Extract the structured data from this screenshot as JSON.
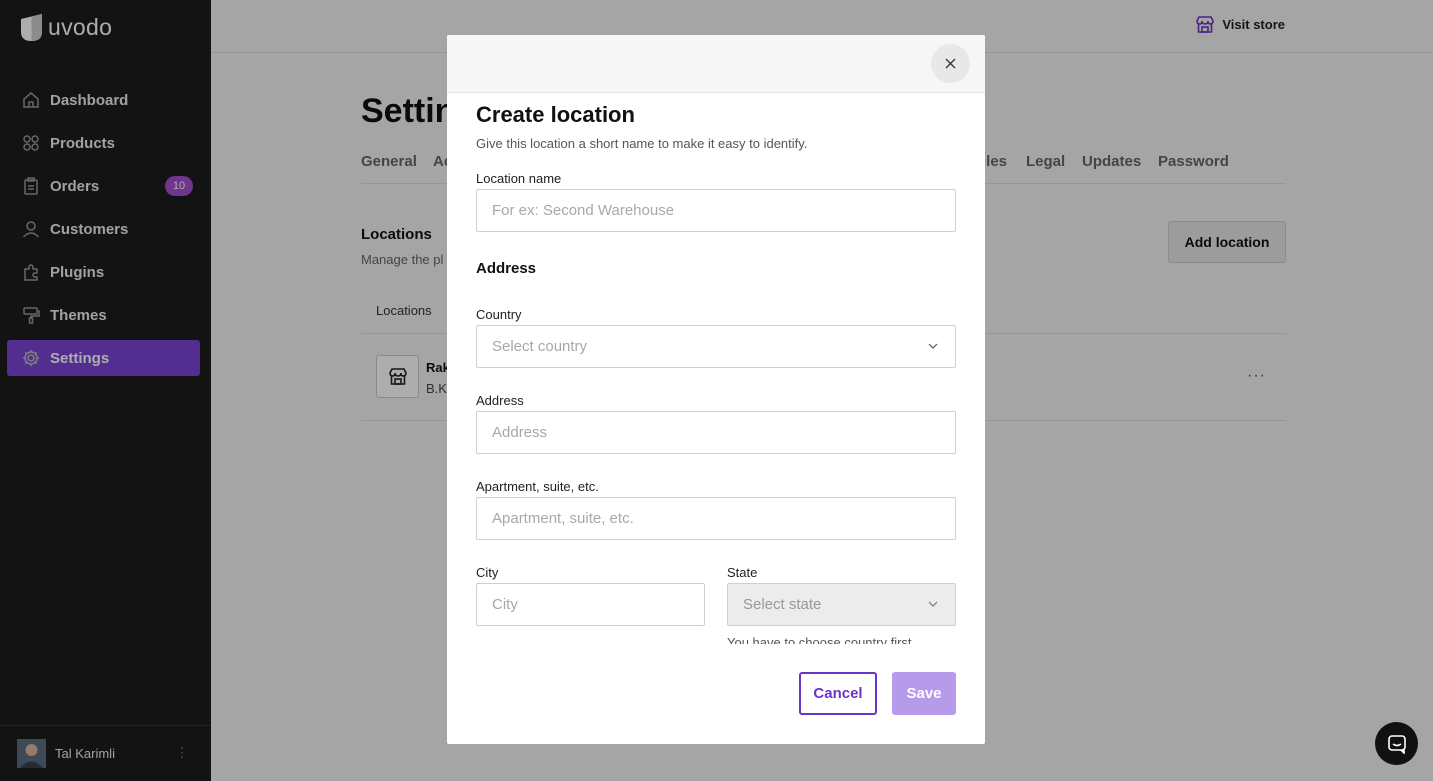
{
  "brand": {
    "name": "uvodo"
  },
  "sidebar": {
    "items": [
      {
        "label": "Dashboard",
        "icon": "home-icon"
      },
      {
        "label": "Products",
        "icon": "grid-icon"
      },
      {
        "label": "Orders",
        "icon": "clipboard-icon",
        "badge": "10"
      },
      {
        "label": "Customers",
        "icon": "user-icon"
      },
      {
        "label": "Plugins",
        "icon": "puzzle-icon"
      },
      {
        "label": "Themes",
        "icon": "paint-roller-icon"
      },
      {
        "label": "Settings",
        "icon": "gear-icon",
        "active": true
      }
    ],
    "user": {
      "name": "Tal Karimli"
    }
  },
  "topbar": {
    "visit_store": "Visit store"
  },
  "page": {
    "title": "Settin",
    "tabs": [
      "General",
      "Ac",
      "iles",
      "Legal",
      "Updates",
      "Password"
    ],
    "locations": {
      "title": "Locations",
      "subtitle": "Manage the pl",
      "add_button": "Add location",
      "table_header": "Locations",
      "row": {
        "name": "Rak",
        "address": "B.Kl"
      }
    }
  },
  "modal": {
    "title": "Create location",
    "subtitle": "Give this location a short name to make it easy to identify.",
    "location_name": {
      "label": "Location name",
      "placeholder": "For ex: Second Warehouse"
    },
    "address_heading": "Address",
    "country": {
      "label": "Country",
      "placeholder": "Select country"
    },
    "address": {
      "label": "Address",
      "placeholder": "Address"
    },
    "apartment": {
      "label": "Apartment, suite, etc.",
      "placeholder": "Apartment, suite, etc."
    },
    "city": {
      "label": "City",
      "placeholder": "City"
    },
    "state": {
      "label": "State",
      "placeholder": "Select state",
      "hint": "You have to choose country first"
    },
    "cancel": "Cancel",
    "save": "Save"
  },
  "colors": {
    "accent": "#7a44d6",
    "badge": "#a64fcf",
    "save_disabled": "#b59bea"
  }
}
